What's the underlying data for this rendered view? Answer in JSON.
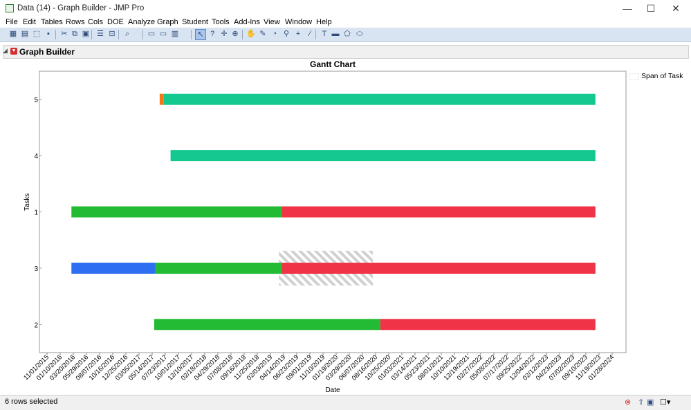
{
  "window": {
    "title": "Data (14) - Graph Builder - JMP Pro",
    "minimize": "—",
    "maximize": "☐",
    "close": "✕"
  },
  "menu": [
    "File",
    "Edit",
    "Tables",
    "Rows",
    "Cols",
    "DOE",
    "Analyze",
    "Graph",
    "Student",
    "Tools",
    "Add-Ins",
    "View",
    "Window",
    "Help"
  ],
  "toolbar_icons": [
    "new-table-icon",
    "new-script-icon",
    "open-icon",
    "save-icon",
    "cut-icon",
    "copy-icon",
    "paste-icon",
    "journal-icon",
    "lock-icon",
    "search-icon",
    "copy-picture-icon",
    "paste-picture-icon",
    "layout-icon",
    "arrow-select-icon",
    "help-icon",
    "crosshair-icon",
    "lasso-icon",
    "grabber-icon",
    "brush-icon",
    "lens-icon",
    "magnifier-icon",
    "plus-icon",
    "line-icon",
    "text-annotate-icon",
    "rect-annotate-icon",
    "polygon-icon",
    "ellipse-icon"
  ],
  "panel": {
    "title": "Graph Builder"
  },
  "status": {
    "text": "6 rows selected"
  },
  "colors": {
    "green": "#22bb33",
    "red": "#f03346",
    "teal": "#13c990",
    "blue": "#2e6ef0",
    "orange": "#f07a1a",
    "hatch": "#cccccc"
  },
  "chart_data": {
    "type": "bar",
    "title": "Gantt Chart",
    "xlabel": "Date",
    "ylabel": "Tasks",
    "legend": [
      "Span of Task"
    ],
    "legend_position": "right",
    "categories": [
      "5",
      "4",
      "1",
      "3",
      "2"
    ],
    "x_ticks": [
      "11/01/2015",
      "01/10/2016",
      "03/20/2016",
      "05/29/2016",
      "08/07/2016",
      "10/16/2016",
      "12/25/2016",
      "03/05/2017",
      "05/14/2017",
      "07/23/2017",
      "10/01/2017",
      "12/10/2017",
      "02/18/2018",
      "04/29/2018",
      "07/08/2018",
      "09/16/2018",
      "11/25/2018",
      "02/03/2019",
      "04/14/2019",
      "06/23/2019",
      "09/01/2019",
      "11/10/2019",
      "01/19/2020",
      "03/29/2020",
      "06/07/2020",
      "08/16/2020",
      "10/25/2020",
      "01/03/2021",
      "03/14/2021",
      "05/23/2021",
      "08/01/2021",
      "10/10/2021",
      "12/19/2021",
      "02/27/2022",
      "05/08/2022",
      "07/17/2022",
      "09/25/2022",
      "12/04/2022",
      "02/12/2023",
      "04/23/2023",
      "07/02/2023",
      "09/10/2023",
      "11/19/2023",
      "01/28/2024"
    ],
    "xlim": [
      "11/01/2015",
      "01/28/2024"
    ],
    "segments": [
      {
        "task": "5",
        "start": "06/23/2017",
        "end": "07/15/2017",
        "color": "orange"
      },
      {
        "task": "5",
        "start": "07/15/2017",
        "end": "10/31/2023",
        "color": "teal"
      },
      {
        "task": "4",
        "start": "08/20/2017",
        "end": "10/31/2023",
        "color": "teal"
      },
      {
        "task": "1",
        "start": "03/10/2016",
        "end": "04/05/2019",
        "color": "green"
      },
      {
        "task": "1",
        "start": "04/05/2019",
        "end": "10/31/2023",
        "color": "red"
      },
      {
        "task": "3",
        "start": "03/10/2016",
        "end": "06/01/2017",
        "color": "blue"
      },
      {
        "task": "3",
        "start": "06/01/2017",
        "end": "04/05/2019",
        "color": "green"
      },
      {
        "task": "3",
        "start": "04/05/2019",
        "end": "10/31/2023",
        "color": "red"
      },
      {
        "task": "2",
        "start": "05/25/2017",
        "end": "09/10/2020",
        "color": "green"
      },
      {
        "task": "2",
        "start": "09/10/2020",
        "end": "10/31/2023",
        "color": "red"
      }
    ],
    "highlight": {
      "task": "3",
      "start": "03/20/2019",
      "end": "08/01/2020",
      "pattern": "hatched"
    }
  }
}
